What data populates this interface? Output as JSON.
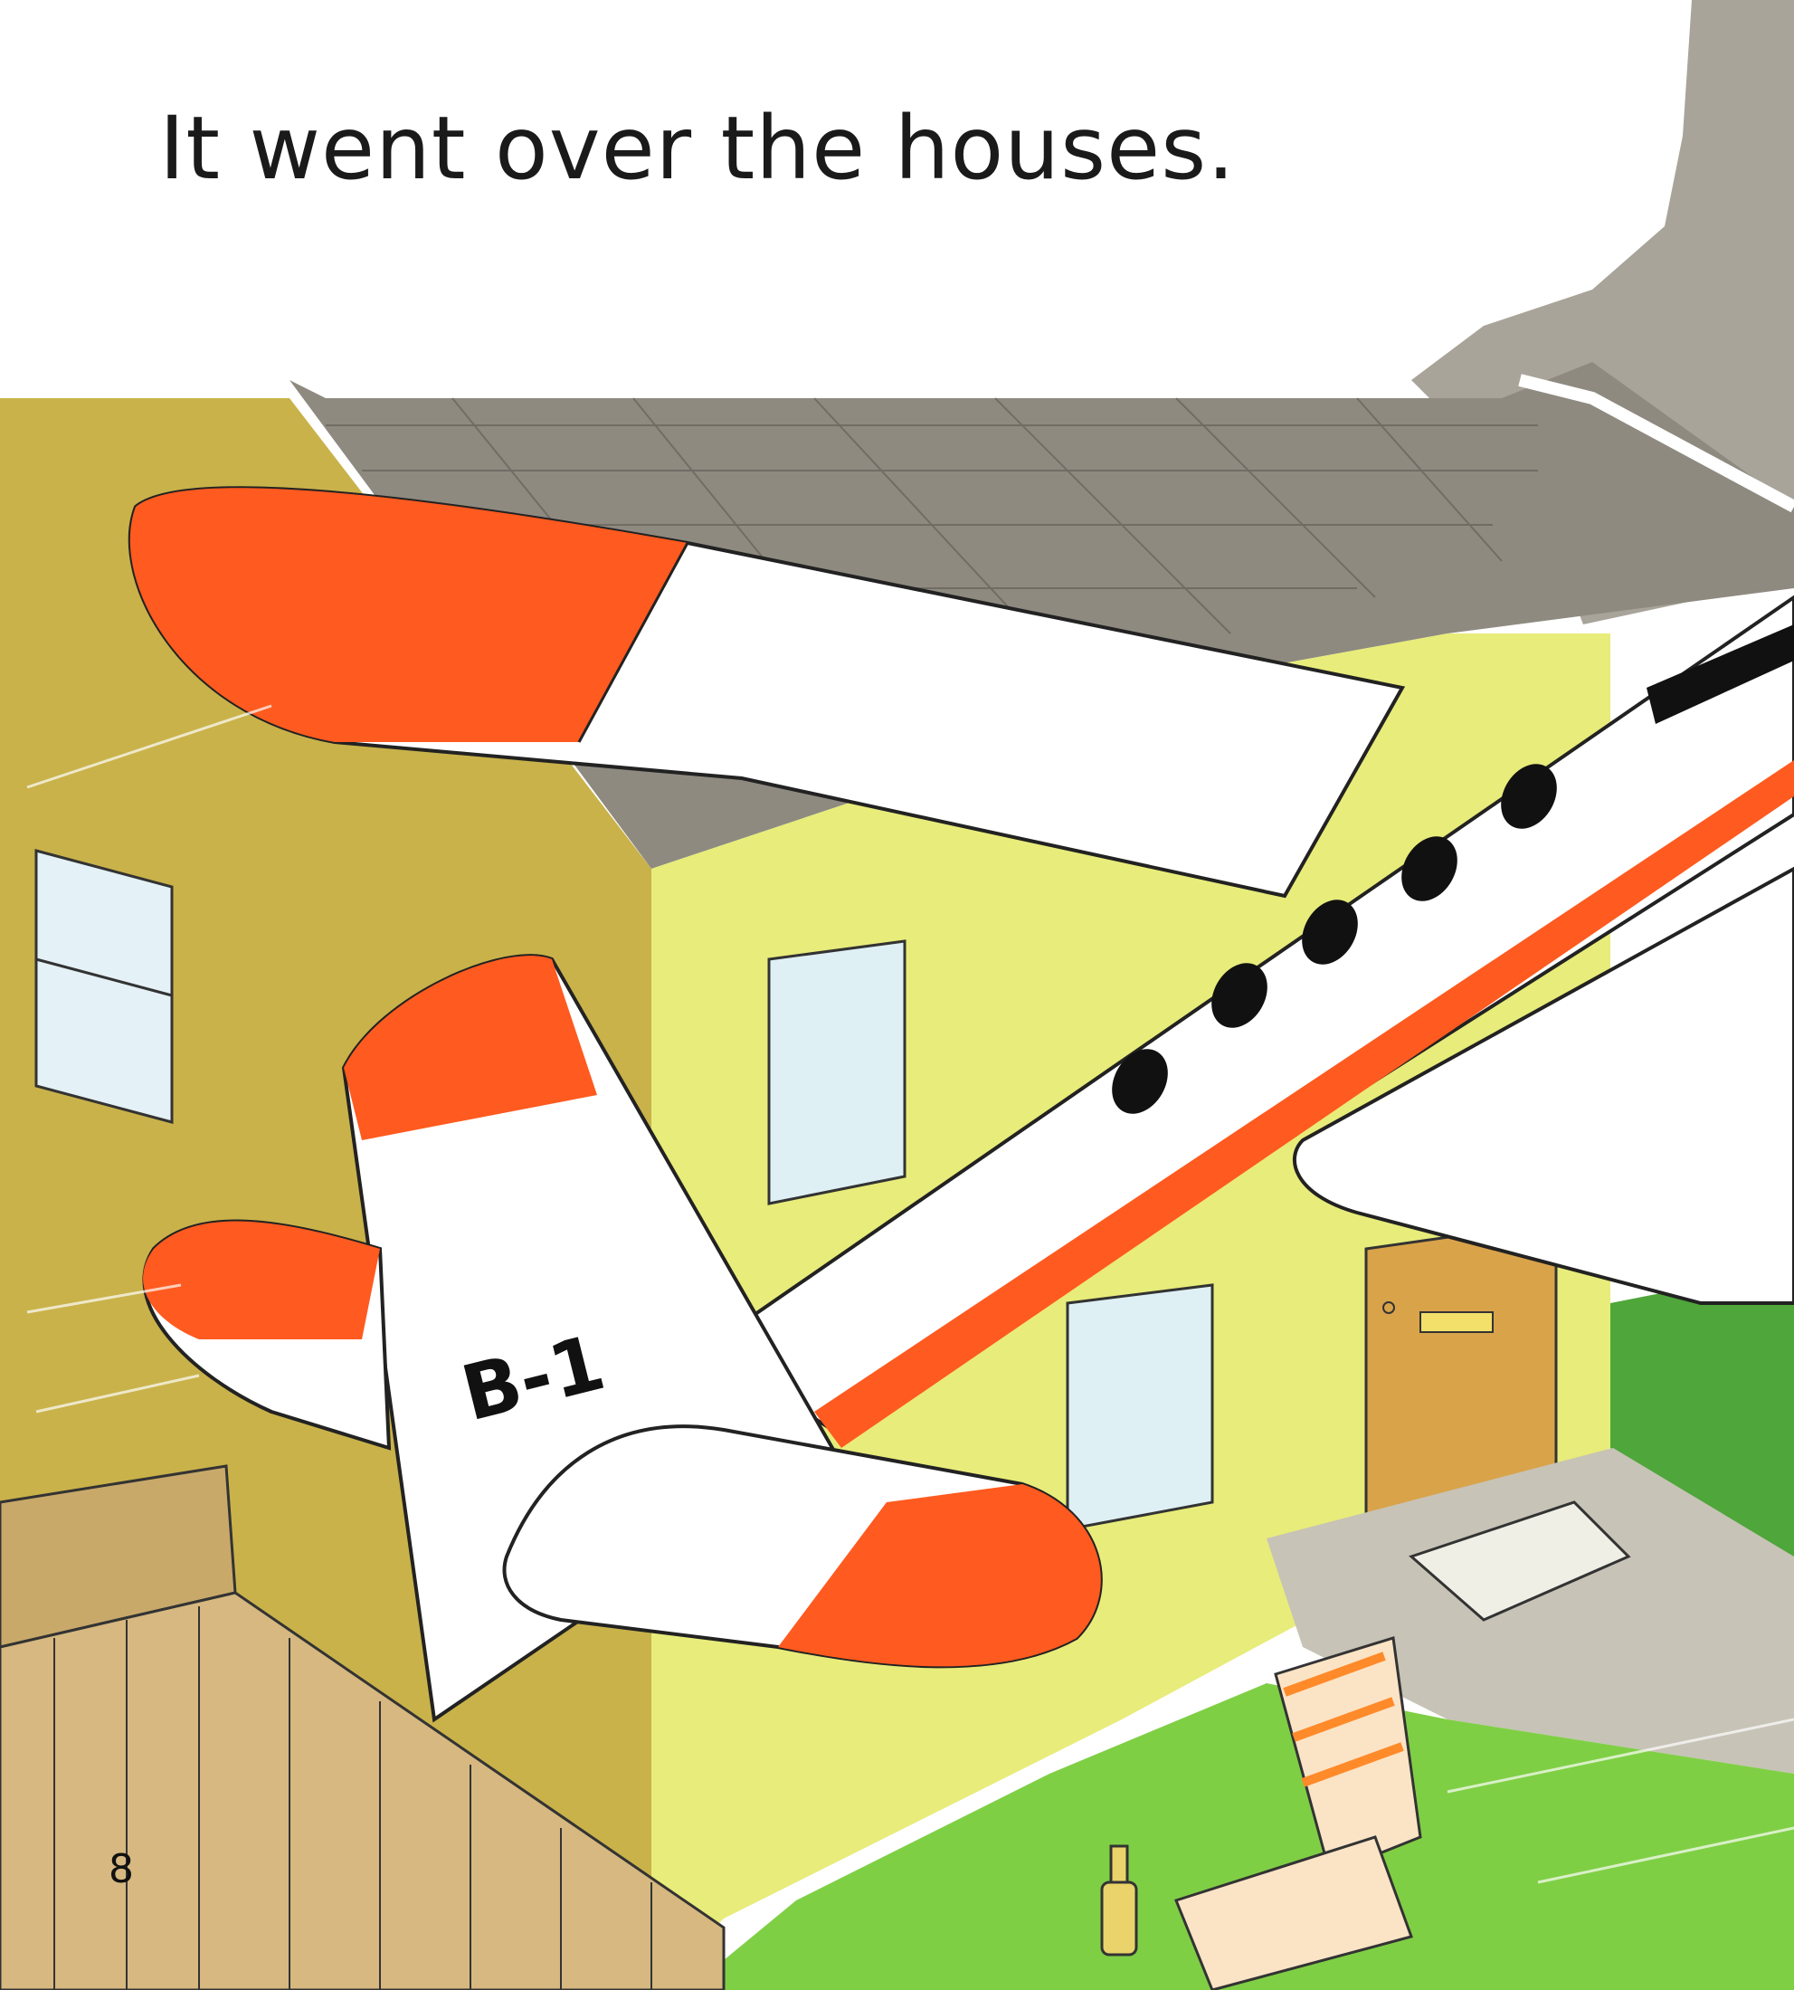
{
  "page": {
    "caption": "It went over the houses.",
    "page_number": "8"
  },
  "illustration": {
    "plane_tail_code": "B-1",
    "colors": {
      "sky": "#ffffff",
      "house_wall": "#e8ec7a",
      "roof": "#8e8a80",
      "side_wall": "#c9b24a",
      "plane_white": "#ffffff",
      "plane_orange": "#ff5a1f",
      "lawn": "#7fcf45",
      "door": "#d9a34a",
      "fence": "#c8a96a"
    }
  }
}
